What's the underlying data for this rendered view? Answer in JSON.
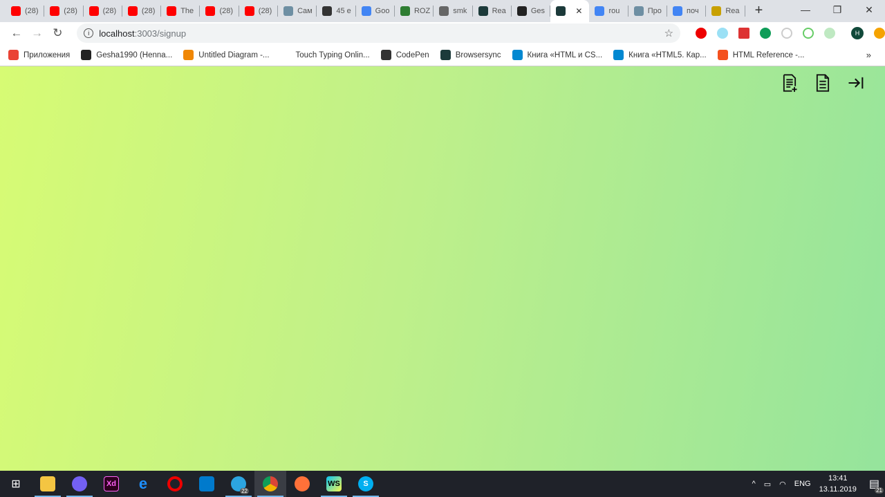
{
  "tabs": [
    {
      "title": "(28)",
      "icon": "youtube",
      "color": "#ff0000"
    },
    {
      "title": "(28)",
      "icon": "youtube",
      "color": "#ff0000"
    },
    {
      "title": "(28)",
      "icon": "youtube",
      "color": "#ff0000"
    },
    {
      "title": "(28)",
      "icon": "youtube",
      "color": "#ff0000"
    },
    {
      "title": "The",
      "icon": "youtube",
      "color": "#ff0000"
    },
    {
      "title": "(28)",
      "icon": "youtube",
      "color": "#ff0000"
    },
    {
      "title": "(28)",
      "icon": "youtube",
      "color": "#ff0000"
    },
    {
      "title": "Cам",
      "icon": "habr",
      "color": "#6e8fa3"
    },
    {
      "title": "45 е",
      "icon": "cat",
      "color": "#333333"
    },
    {
      "title": "Goo",
      "icon": "google-translate",
      "color": "#4285f4"
    },
    {
      "title": "ROZ",
      "icon": "roz",
      "color": "#2e7d32"
    },
    {
      "title": "smk",
      "icon": "globe",
      "color": "#666666"
    },
    {
      "title": "Rea",
      "icon": "react",
      "color": "#1c3a3a"
    },
    {
      "title": "Ges",
      "icon": "github",
      "color": "#222222"
    },
    {
      "title": "",
      "icon": "react",
      "color": "#1c3a3a",
      "active": true
    },
    {
      "title": "rou",
      "icon": "google",
      "color": "#4285f4"
    },
    {
      "title": "Про",
      "icon": "habr",
      "color": "#6e8fa3"
    },
    {
      "title": "поч",
      "icon": "google",
      "color": "#4285f4"
    },
    {
      "title": "Rea",
      "icon": "glasses",
      "color": "#c8a000"
    }
  ],
  "new_tab": "+",
  "window": {
    "minimize": "—",
    "restore": "❐",
    "close": "✕"
  },
  "address": {
    "host": "localhost",
    "path": ":3003/signup"
  },
  "bookmarks": [
    {
      "label": "Приложения",
      "icon": "apps",
      "color": "#ea4335"
    },
    {
      "label": "Gesha1990 (Henna...",
      "icon": "github",
      "color": "#222222"
    },
    {
      "label": "Untitled Diagram -...",
      "icon": "drawio",
      "color": "#f08705"
    },
    {
      "label": "Touch Typing Onlin...",
      "icon": "none",
      "color": "#ffffff"
    },
    {
      "label": "CodePen",
      "icon": "codepen",
      "color": "#333333"
    },
    {
      "label": "Browsersync",
      "icon": "react",
      "color": "#1c3a3a"
    },
    {
      "label": "Книга «HTML и CS...",
      "icon": "book",
      "color": "#0288d1"
    },
    {
      "label": "Книга «HTML5. Кар...",
      "icon": "book",
      "color": "#0288d1"
    },
    {
      "label": "HTML Reference -...",
      "icon": "html",
      "color": "#f4511e"
    }
  ],
  "bookmarks_more": "»",
  "profile_initial": "H",
  "page": {
    "icons": [
      "add-document-icon",
      "document-icon",
      "sign-in-icon"
    ]
  },
  "taskbar": {
    "telegram_badge": "22",
    "lang": "ENG",
    "time": "13:41",
    "date": "13.11.2019",
    "notifications": "21"
  }
}
